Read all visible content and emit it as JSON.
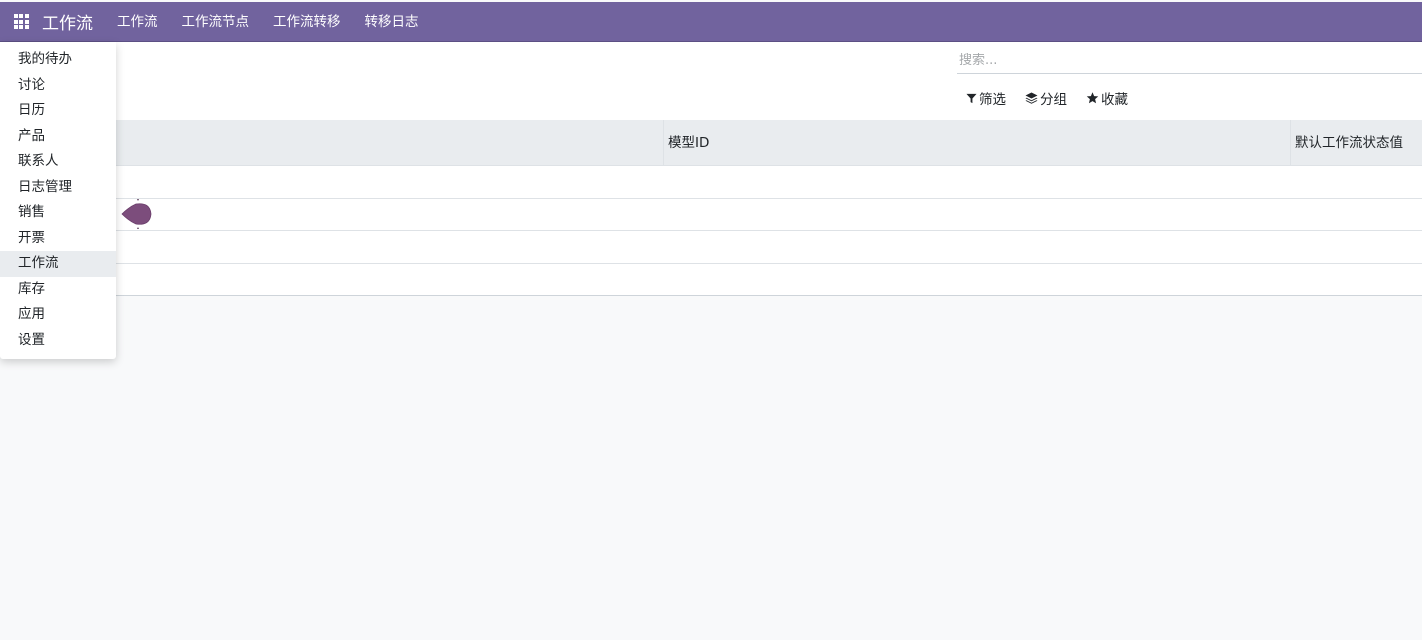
{
  "topbar": {
    "brand": "工作流",
    "nav": [
      "工作流",
      "工作流节点",
      "工作流转移",
      "转移日志"
    ],
    "accent_color": "#71639e"
  },
  "search": {
    "placeholder": "搜索...",
    "value": ""
  },
  "search_options": {
    "filter": "筛选",
    "group": "分组",
    "favorite": "收藏"
  },
  "table": {
    "columns": [
      "",
      "模型ID",
      "默认工作流状态值"
    ],
    "rows": [
      [],
      [],
      [],
      []
    ]
  },
  "app_menu": {
    "items": [
      "我的待办",
      "讨论",
      "日历",
      "产品",
      "联系人",
      "日志管理",
      "销售",
      "开票",
      "工作流",
      "库存",
      "应用",
      "设置"
    ],
    "active": "工作流"
  },
  "icons": {
    "apps": "apps-grid-icon",
    "filter": "filter-icon",
    "group": "layers-icon",
    "favorite": "star-icon",
    "drag": "drag-handle-icon"
  }
}
